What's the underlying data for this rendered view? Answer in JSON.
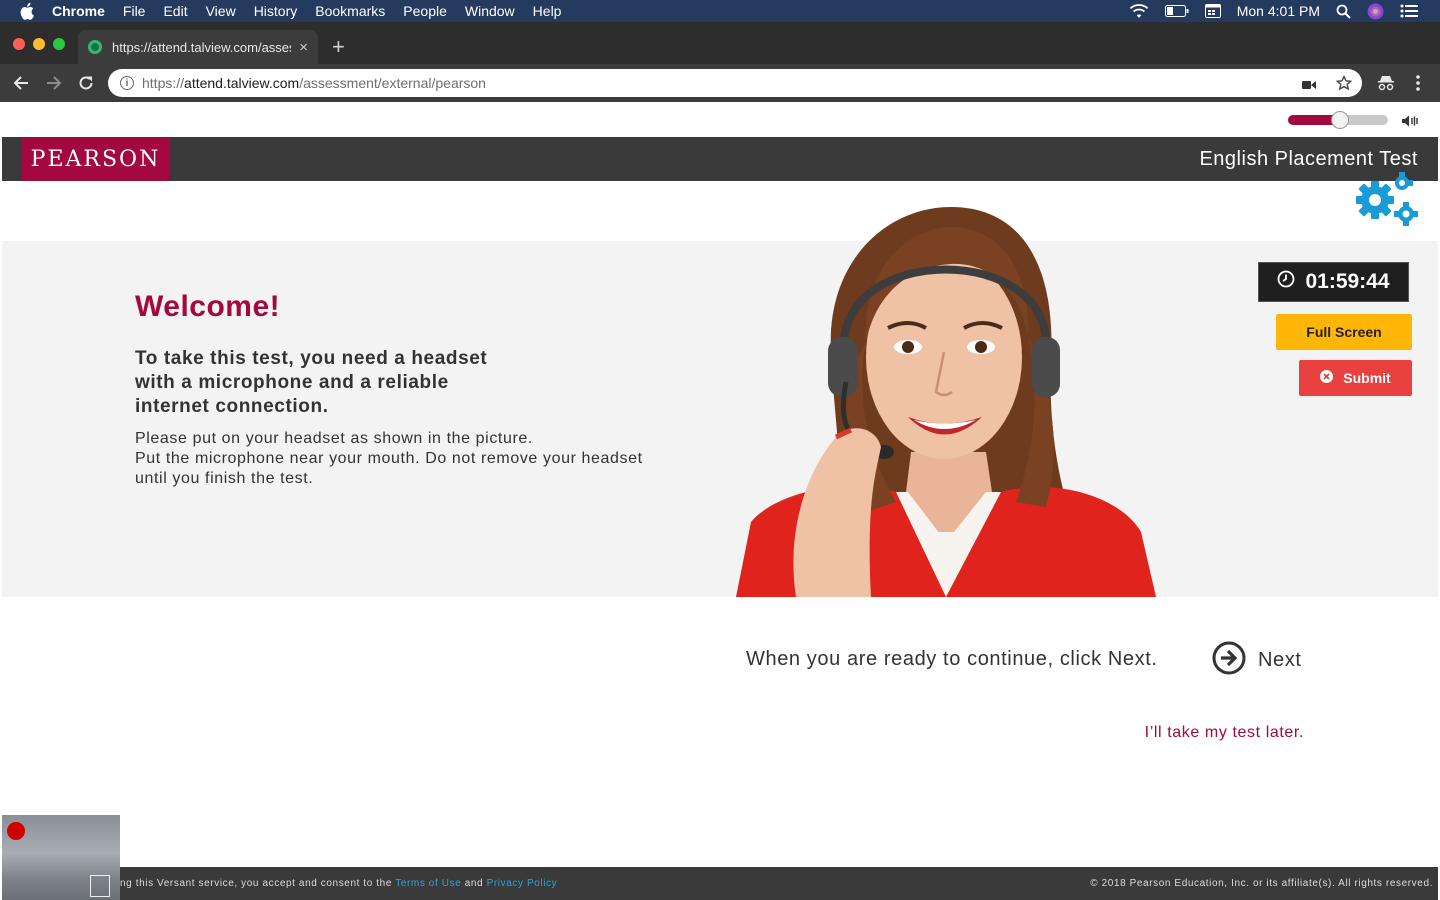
{
  "menubar": {
    "app_name": "Chrome",
    "items": [
      "File",
      "Edit",
      "View",
      "History",
      "Bookmarks",
      "People",
      "Window",
      "Help"
    ],
    "clock": "Mon 4:01 PM",
    "icons": [
      "apple-icon",
      "wifi-icon",
      "battery-icon",
      "calendar-icon",
      "spotlight-search-icon",
      "siri-icon",
      "notification-center-icon"
    ]
  },
  "browser": {
    "tab_title": "https://attend.talview.com/assessment/external/pearson",
    "new_tab_symbol": "+",
    "tab_close_symbol": "×",
    "url_scheme": "https://",
    "url_host": "attend.talview.com",
    "url_path": "/assessment/external/pearson"
  },
  "header": {
    "logo": "PEARSON",
    "test_title": "English Placement Test"
  },
  "volume": {
    "level": 0.52
  },
  "welcome": {
    "heading": "Welcome!",
    "strong_lines": [
      "To take this test, you need a headset",
      "with a microphone and a reliable",
      "internet connection."
    ],
    "body_lines": [
      "Please put on your headset as shown in the picture.",
      "Put the microphone near your mouth. Do not remove your headset",
      "until you finish the test."
    ]
  },
  "controls": {
    "timer": "01:59:44",
    "full_screen_label": "Full Screen",
    "submit_label": "Submit"
  },
  "navigation": {
    "continue_text": "When you are ready to continue, click Next.",
    "next_label": "Next",
    "later_link": "I’ll take my test later."
  },
  "footer": {
    "consent_prefix": "ng this Versant service, you accept and consent to the",
    "terms_link": "Terms of Use",
    "and_word": "and",
    "privacy_link": "Privacy Policy",
    "copyright": "© 2018 Pearson Education, Inc. or its affiliate(s). All rights reserved."
  },
  "colors": {
    "brand": "#a3083f",
    "header_bg": "#3a3a3a",
    "full_screen_bg": "#ffb606",
    "submit_bg": "#e8413f",
    "link_blue": "#2ba5e0",
    "gear_blue": "#1a9ad6"
  }
}
